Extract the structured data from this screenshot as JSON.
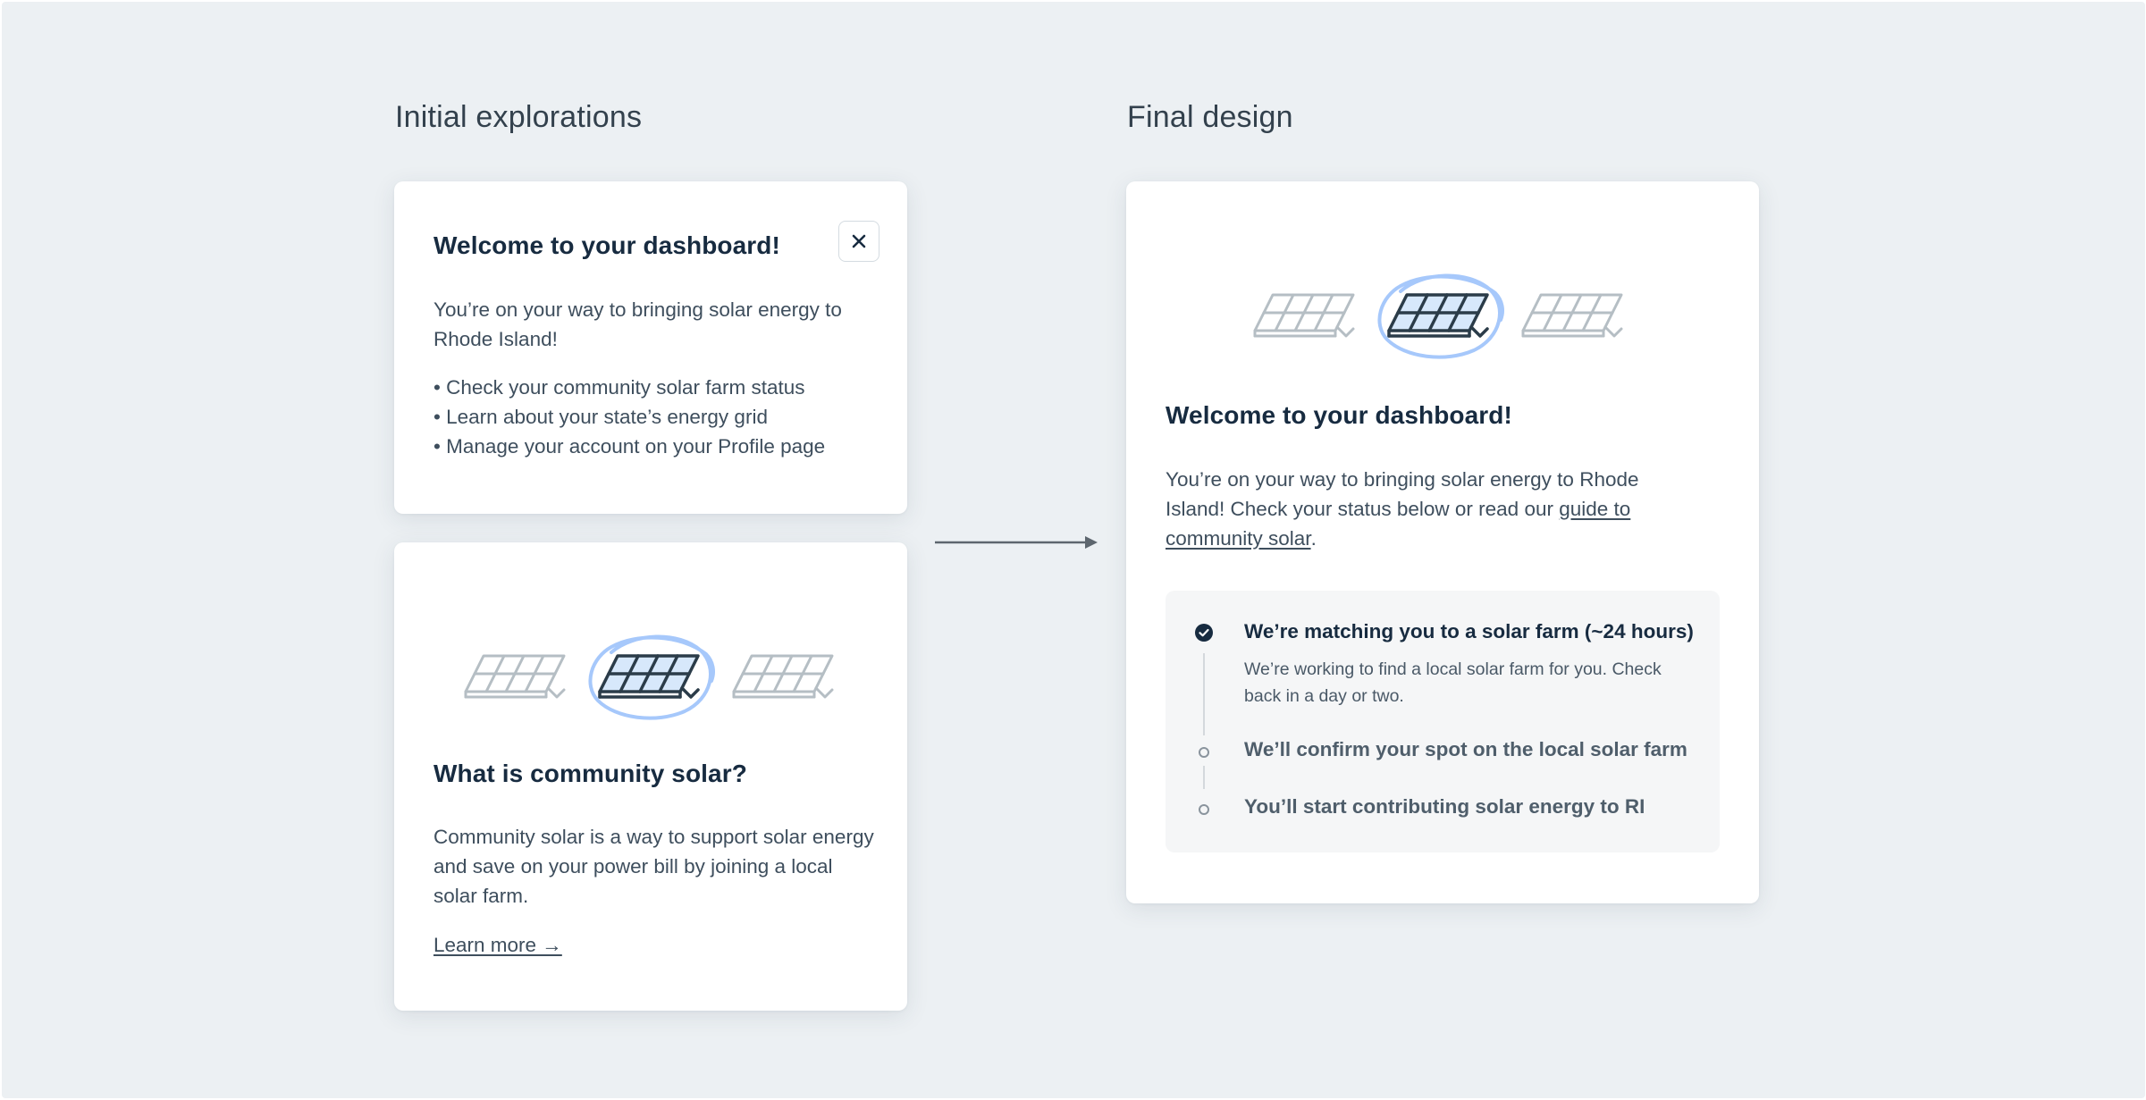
{
  "left_column": {
    "title": "Initial explorations",
    "card1": {
      "heading": "Welcome to your dashboard!",
      "close_label": "✕",
      "intro": "You’re on your way to bringing solar energy to Rhode Island!",
      "bullets": [
        "Check your community solar farm status",
        "Learn about your state’s energy grid",
        "Manage your account on your Profile page"
      ]
    },
    "card2": {
      "heading": "What is community solar?",
      "body": "Community solar is a way to support solar energy and save on your power bill by joining a local solar farm.",
      "link": "Learn more →"
    }
  },
  "right_column": {
    "title": "Final design",
    "card": {
      "heading": "Welcome to your dashboard!",
      "intro_before_link": "You’re on your way to bringing solar energy to Rhode Island! Check your status below or read our ",
      "intro_link": "guide to community solar",
      "intro_after_link": ".",
      "steps": [
        {
          "title": "We’re matching you to a solar farm (~24 hours)",
          "desc": "We’re working to find a local solar farm for you. Check back in a day or two.",
          "state": "active"
        },
        {
          "title": "We’ll confirm your spot on the local solar farm",
          "state": "pending"
        },
        {
          "title": "You’ll start contributing solar energy to RI",
          "state": "pending"
        }
      ]
    }
  },
  "icons": [
    "close-icon",
    "solar-panel-icon",
    "check-circle-icon",
    "arrow-right-icon"
  ],
  "colors": {
    "background": "#ecf0f3",
    "card": "#ffffff",
    "heading": "#172b40",
    "body_text": "#3e4e5d",
    "panel_gray": "#b5bec4",
    "panel_highlight": "#d7e8fb",
    "circle_accent": "#a6c8fb",
    "panel_dark": "#2b3c49"
  }
}
